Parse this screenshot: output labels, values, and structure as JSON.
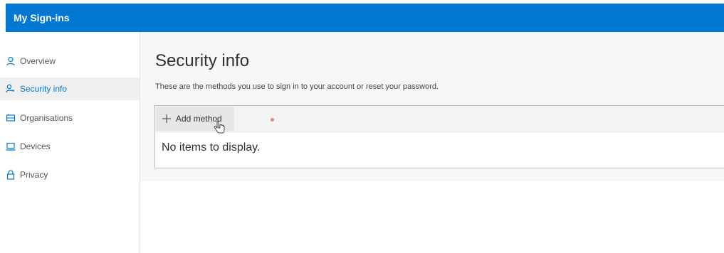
{
  "header": {
    "app_title": "My Sign-ins",
    "color": "#0078d4"
  },
  "sidebar": {
    "items": [
      {
        "label": "Overview",
        "icon": "person-icon",
        "active": false
      },
      {
        "label": "Security info",
        "icon": "security-info-icon",
        "active": true
      },
      {
        "label": "Organisations",
        "icon": "organisations-icon",
        "active": false
      },
      {
        "label": "Devices",
        "icon": "devices-icon",
        "active": false
      },
      {
        "label": "Privacy",
        "icon": "lock-icon",
        "active": false
      }
    ]
  },
  "main": {
    "title": "Security info",
    "subtitle": "These are the methods you use to sign in to your account or reset your password.",
    "add_method_label": "Add method",
    "empty_message": "No items to display."
  }
}
